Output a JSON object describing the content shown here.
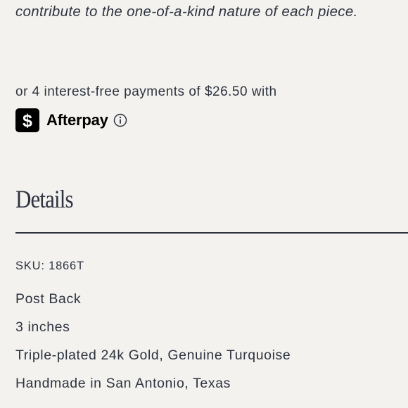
{
  "intro_text": "contribute to the one-of-a-kind nature of each piece.",
  "payment": {
    "installments_text": "or 4 interest-free payments of $26.50 with",
    "provider_name": "Afterpay",
    "provider_icon": "dollar-sign-icon",
    "info_icon": "info-circle-icon"
  },
  "details": {
    "heading": "Details",
    "sku": "SKU: 1866T",
    "items": [
      "Post Back",
      "3 inches",
      "Triple-plated 24k Gold, Genuine Turquoise",
      "Handmade in San Antonio, Texas"
    ]
  },
  "colors": {
    "background": "#f4f2ee",
    "text": "#2d3440",
    "afterpay_badge": "#000000"
  }
}
